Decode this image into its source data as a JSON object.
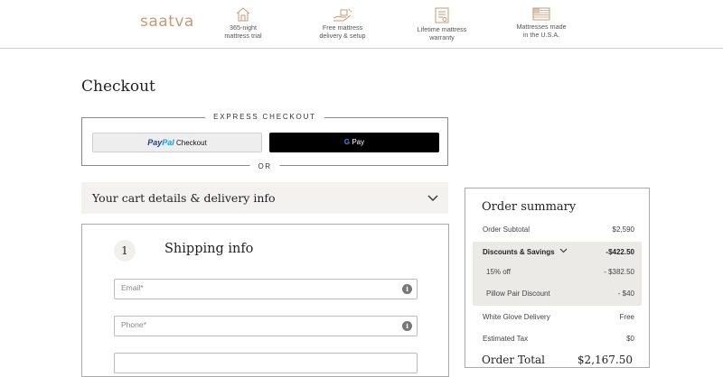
{
  "header": {
    "logo": "saatva",
    "features": [
      {
        "icon": "home-trial-icon",
        "text": "365-night\nmattress trial"
      },
      {
        "icon": "delivery-hand-icon",
        "text": "Free mattress\ndelivery & setup"
      },
      {
        "icon": "warranty-document-icon",
        "text": "Lifetime mattress\nwarranty"
      },
      {
        "icon": "usa-flag-icon",
        "text": "Mattresses made\nin the U.S.A."
      }
    ]
  },
  "page": {
    "title": "Checkout"
  },
  "express": {
    "label": "EXPRESS CHECKOUT",
    "paypal_p1": "Pay",
    "paypal_p2": "Pal",
    "paypal_checkout": "Checkout",
    "gpay_label": "Pay",
    "or_label": "OR"
  },
  "cart": {
    "title": "Your cart details & delivery info"
  },
  "shipping": {
    "step_number": "1",
    "title": "Shipping info",
    "email_placeholder": "Email*",
    "phone_placeholder": "Phone*",
    "info_glyph": "i"
  },
  "summary": {
    "title": "Order summary",
    "subtotal_label": "Order Subtotal",
    "subtotal_value": "$2,590",
    "discounts_label": "Discounts & Savings",
    "discounts_value": "-$422.50",
    "discount_items": [
      {
        "label": "15% off",
        "value": "- $382.50"
      },
      {
        "label": "Pillow Pair Discount",
        "value": "- $40"
      }
    ],
    "delivery_label": "White Glove Delivery",
    "delivery_value": "Free",
    "tax_label": "Estimated Tax",
    "tax_value": "$0",
    "total_label": "Order Total",
    "total_value": "$2,167.50"
  },
  "colors": {
    "brand": "#c29b7a",
    "panel": "#f3f2ef",
    "discount_bg": "#ebeae6"
  }
}
